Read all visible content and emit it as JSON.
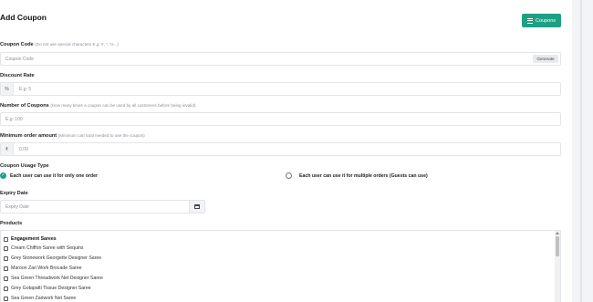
{
  "header": {
    "title": "Add Coupon",
    "coupons_button": "Coupons"
  },
  "coupon_code": {
    "label": "Coupon Code",
    "hint": "(Do not use special characters E.g: #, *, %...)",
    "placeholder": "Coupon Code",
    "generate_label": "Generate"
  },
  "discount_rate": {
    "label": "Discount Rate",
    "prefix": "%",
    "placeholder": "E.g: 5"
  },
  "number_of_coupons": {
    "label": "Number of Coupons",
    "hint": "(How many times a coupon can be used by all customers before being invalid)",
    "placeholder": "E.g: 100"
  },
  "minimum_order": {
    "label": "Minimum order amount",
    "hint": "(Minimum cart total needed to use the coupon)",
    "prefix": "₹",
    "placeholder": "0.00"
  },
  "usage_type": {
    "label": "Coupon Usage Type",
    "options": [
      {
        "label": "Each user can use it for only one order",
        "selected": true
      },
      {
        "label": "Each user can use it for multiple orders (Guests can use)",
        "selected": false
      }
    ]
  },
  "expiry_date": {
    "label": "Expiry Date",
    "placeholder": "Expiry Date"
  },
  "products": {
    "label": "Products",
    "items": [
      {
        "label": "Engagement Sarees",
        "is_group": true,
        "checked": false
      },
      {
        "label": "Cream Chiffon Saree with Sequins",
        "is_group": false,
        "checked": false
      },
      {
        "label": "Grey Stonework Georgette Designer Saree",
        "is_group": false,
        "checked": false
      },
      {
        "label": "Maroon Zari Work Brocade Saree",
        "is_group": false,
        "checked": false
      },
      {
        "label": "Sea Green Threadwork Net Designer Saree",
        "is_group": false,
        "checked": false
      },
      {
        "label": "Grey Gotapatti Tissue Designer Saree",
        "is_group": false,
        "checked": false
      },
      {
        "label": "Sea Green Zariwork Net Saree",
        "is_group": false,
        "checked": false
      }
    ]
  },
  "colors": {
    "accent": "#1f9f83",
    "border": "#e3e5e9",
    "page_bg": "#f3f4f6"
  },
  "icons": {
    "coupons_button": "list-icon",
    "calendar": "calendar-icon",
    "radio_selected": "check-icon"
  }
}
